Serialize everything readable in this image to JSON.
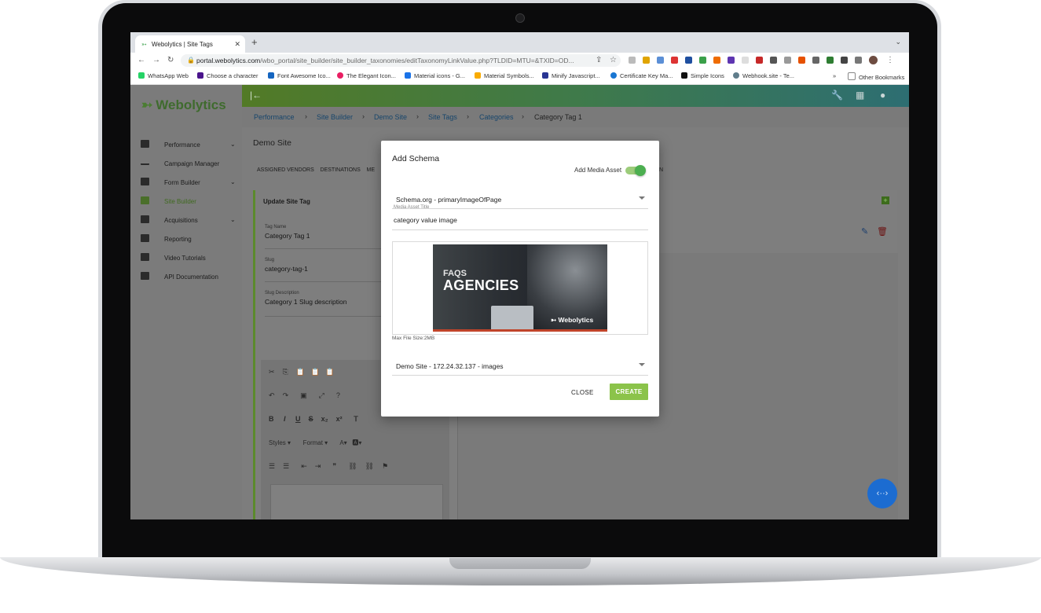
{
  "browser": {
    "tab_title": "Webolytics | Site Tags",
    "url_host": "portal.webolytics.com",
    "url_path": "/wbo_portal/site_builder/site_builder_taxonomies/editTaxonomyLinkValue.php?TLDID=MTU=&TXID=OD...",
    "bookmarks": [
      "WhatsApp Web",
      "Choose a character",
      "Font Awesome Ico...",
      "The Elegant Icon...",
      "Material icons - G...",
      "Material Symbols...",
      "Minify Javascript...",
      "Certificate Key Ma...",
      "Simple Icons",
      "Webhook.site - Te..."
    ],
    "bookmarks_overflow": "»",
    "other_bookmarks": "Other Bookmarks"
  },
  "app": {
    "logo": "Webolytics",
    "nav": [
      {
        "label": "Performance",
        "has_children": true
      },
      {
        "label": "Campaign Manager",
        "has_children": false
      },
      {
        "label": "Form Builder",
        "has_children": true
      },
      {
        "label": "Site Builder",
        "has_children": false,
        "active": true
      },
      {
        "label": "Acquisitions",
        "has_children": true
      },
      {
        "label": "Reporting",
        "has_children": false
      },
      {
        "label": "Video Tutorials",
        "has_children": false
      },
      {
        "label": "API Documentation",
        "has_children": false
      }
    ],
    "breadcrumbs": [
      "Performance",
      "Site Builder",
      "Demo Site",
      "Site Tags",
      "Categories",
      "Category Tag 1"
    ],
    "page_title": "Demo Site",
    "subtabs": [
      "ASSIGNED VENDORS",
      "DESTINATIONS",
      "ME",
      "N"
    ],
    "card": {
      "title": "Update Site Tag",
      "fields": [
        {
          "label": "Tag Name",
          "value": "Category Tag 1"
        },
        {
          "label": "Slug",
          "value": "category-tag-1"
        },
        {
          "label": "Slug Description",
          "value": "Category 1 Slug description"
        }
      ]
    },
    "editor": {
      "styles_label": "Styles",
      "format_label": "Format"
    }
  },
  "modal": {
    "title": "Add Schema",
    "toggle_label": "Add Media Asset",
    "toggle_on": true,
    "schema_select": "Schema.org - primaryImageOfPage",
    "media_title_label": "Media Asset Title",
    "media_title_value": "category value image",
    "image_text_small": "FAQS",
    "image_text_big": "AGENCIES",
    "image_brand": "Webolytics",
    "max_file_hint": "Max File Size:2MB",
    "site_select": "Demo Site - 172.24.32.137 - images",
    "close_label": "CLOSE",
    "create_label": "CREATE",
    "accent": "#8bc34a"
  }
}
